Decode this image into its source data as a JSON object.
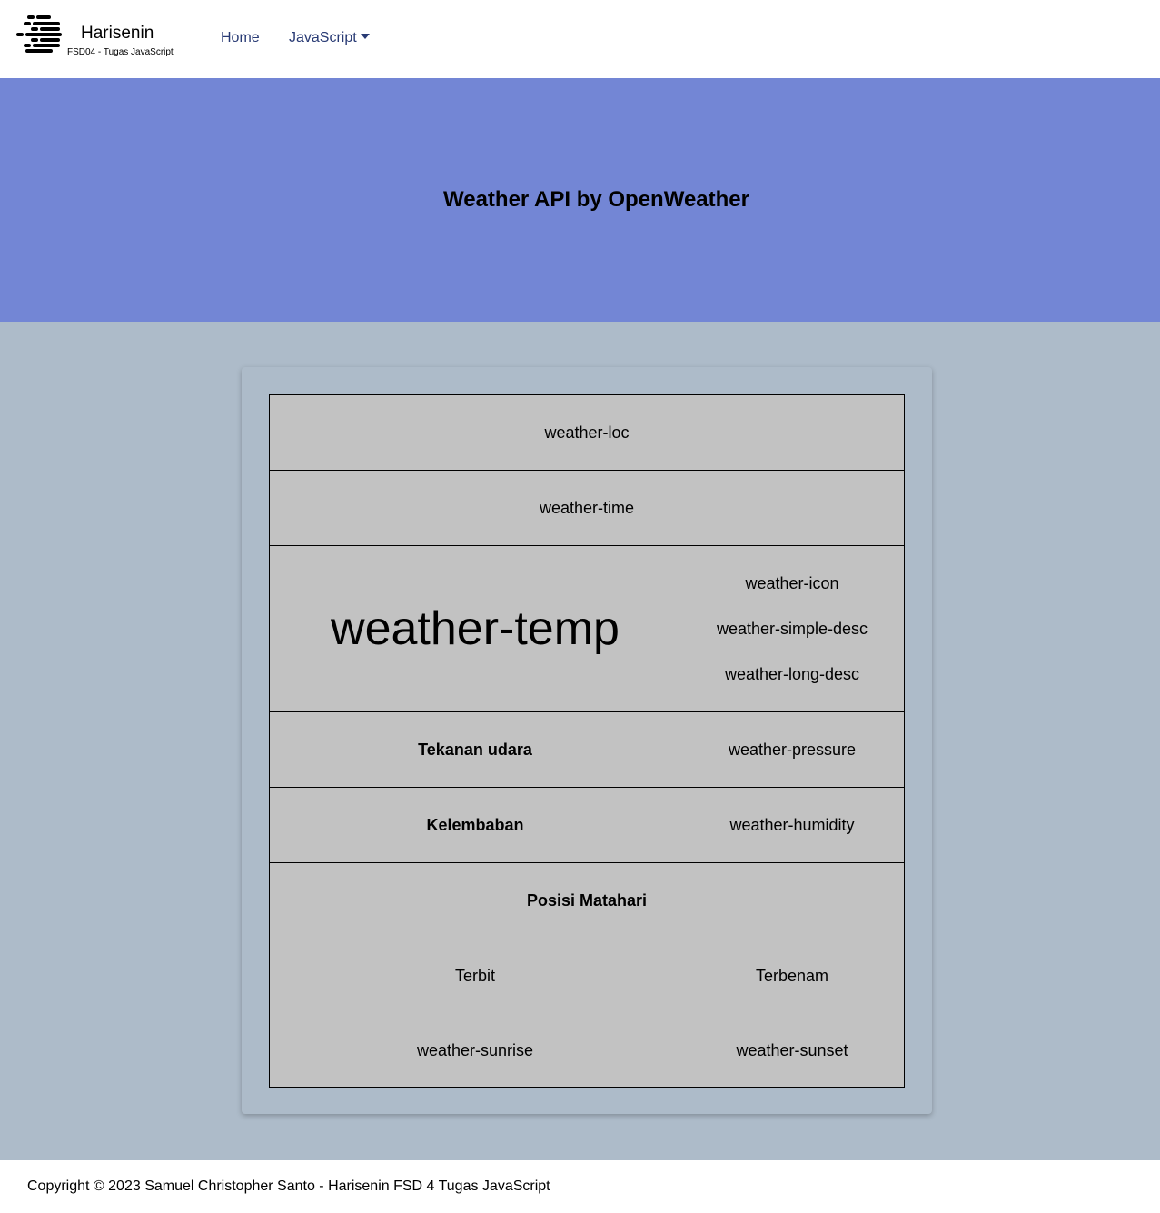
{
  "colors": {
    "hero_bg": "#7386d5",
    "main_bg": "#adbbc9",
    "card_bg": "#adbbc9",
    "table_bg": "#c2c2c2",
    "nav_link": "#283a74"
  },
  "navbar": {
    "brand_name": "Harisenin",
    "brand_sub": "FSD04 - Tugas JavaScript",
    "logo_icon": "harisenin-logo-icon",
    "links": [
      {
        "label": "Home"
      },
      {
        "label": "JavaScript"
      }
    ]
  },
  "hero": {
    "title": "Weather API by OpenWeather"
  },
  "weather": {
    "loc": "weather-loc",
    "time": "weather-time",
    "temp": "weather-temp",
    "icon": "weather-icon",
    "simple_desc": "weather-simple-desc",
    "long_desc": "weather-long-desc",
    "pressure_label": "Tekanan udara",
    "pressure": "weather-pressure",
    "humidity_label": "Kelembaban",
    "humidity": "weather-humidity",
    "sun_title": "Posisi Matahari",
    "sunrise_label": "Terbit",
    "sunset_label": "Terbenam",
    "sunrise": "weather-sunrise",
    "sunset": "weather-sunset"
  },
  "footer": {
    "copyright": "Copyright © 2023 Samuel Christopher Santo - Harisenin FSD 4 Tugas JavaScript"
  }
}
